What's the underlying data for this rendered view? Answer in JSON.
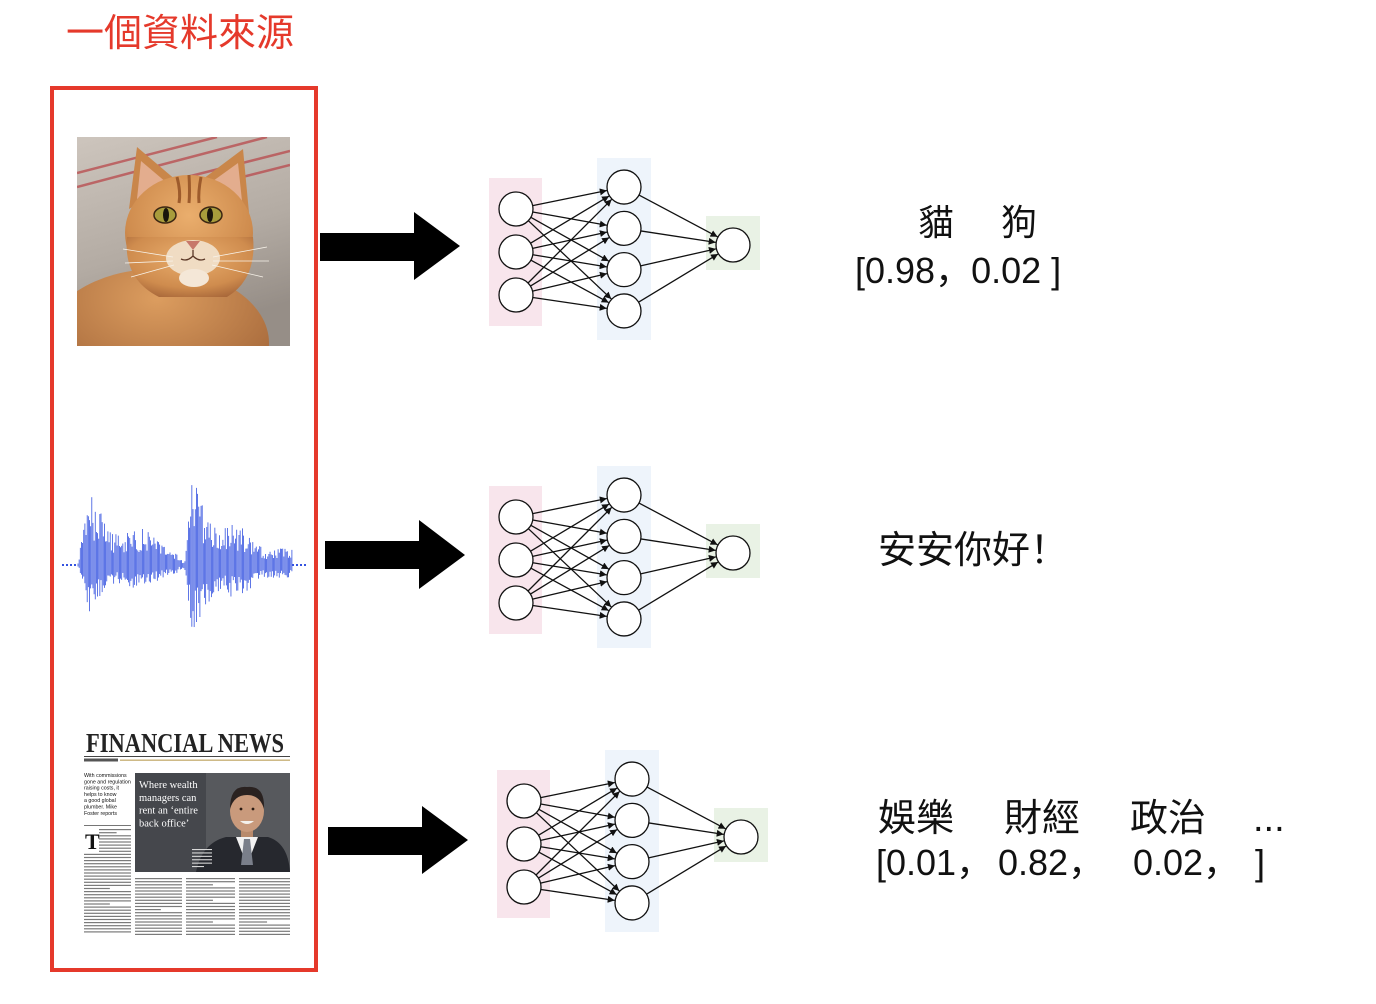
{
  "title": "一個資料來源",
  "colors": {
    "accent": "#e5392b",
    "arrow": "#000000",
    "input_layer": "#f8e5ec",
    "hidden_layer": "#eef4fb",
    "output_layer": "#e9f2e5",
    "waveform": "#3553e0",
    "node_stroke": "#111111"
  },
  "network": {
    "layers": [
      3,
      4,
      1
    ]
  },
  "sources": {
    "image": {
      "icon": "cat-photo"
    },
    "audio": {
      "icon": "speech-waveform"
    },
    "text": {
      "icon": "newspaper-page",
      "masthead": "FINANCIAL NEWS",
      "standfirst_lines": [
        "With commissions",
        "gone and regulation",
        "raising costs, it",
        "helps to know",
        "a good global",
        "plumber. Mike",
        "Foster reports"
      ],
      "headline_lines": [
        "Where wealth",
        "managers can",
        "rent an ‘entire",
        "back office’"
      ],
      "drop_cap": "T"
    }
  },
  "outputs": {
    "image_classification": {
      "labels": [
        "貓",
        "狗"
      ],
      "values": "[0.98，0.02 ]"
    },
    "speech_recognition": {
      "text": "安安你好！"
    },
    "text_classification": {
      "labels": [
        "娛樂",
        "財經",
        "政治",
        "..."
      ],
      "values": [
        "[0.01，",
        "0.82，",
        "0.02，",
        "]"
      ]
    }
  }
}
